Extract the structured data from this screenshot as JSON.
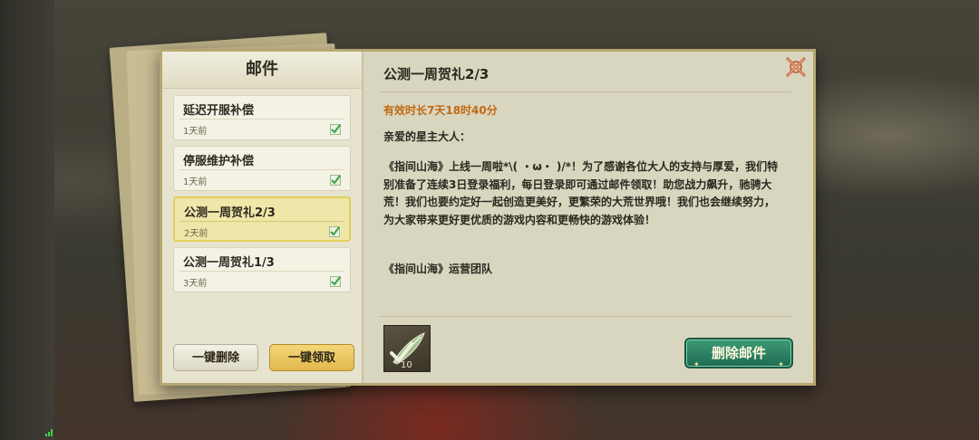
{
  "mailbox": {
    "title": "邮件",
    "items": [
      {
        "subject": "延迟开服补偿",
        "time": "1天前"
      },
      {
        "subject": "停服维护补偿",
        "time": "1天前"
      },
      {
        "subject": "公测一周贺礼2/3",
        "time": "2天前"
      },
      {
        "subject": "公测一周贺礼1/3",
        "time": "3天前"
      }
    ],
    "delete_all_label": "一键删除",
    "claim_all_label": "一键领取"
  },
  "mail": {
    "title": "公测一周贺礼2/3",
    "validity": "有效时长7天18时40分",
    "greeting": "亲爱的星主大人：",
    "body": "《指间山海》上线一周啦*\\(  ・ω・ )/*！为了感谢各位大人的支持与厚爱，我们特别准备了连续3日登录福利，每日登录即可通过邮件领取！助您战力飙升，驰骋大荒！我们也要约定好一起创造更美好，更繁荣的大荒世界哦！我们也会继续努力，为大家带来更好更优质的游戏内容和更畅快的游戏体验！",
    "signature": "《指间山海》运营团队",
    "attachment": {
      "icon": "feather-scroll-icon",
      "quantity": "10"
    },
    "delete_label": "删除邮件"
  },
  "colors": {
    "validity": "#c06a12",
    "delete_button": "#2a8061",
    "claim_button": "#e6c05a",
    "check": "#3aa04a"
  }
}
